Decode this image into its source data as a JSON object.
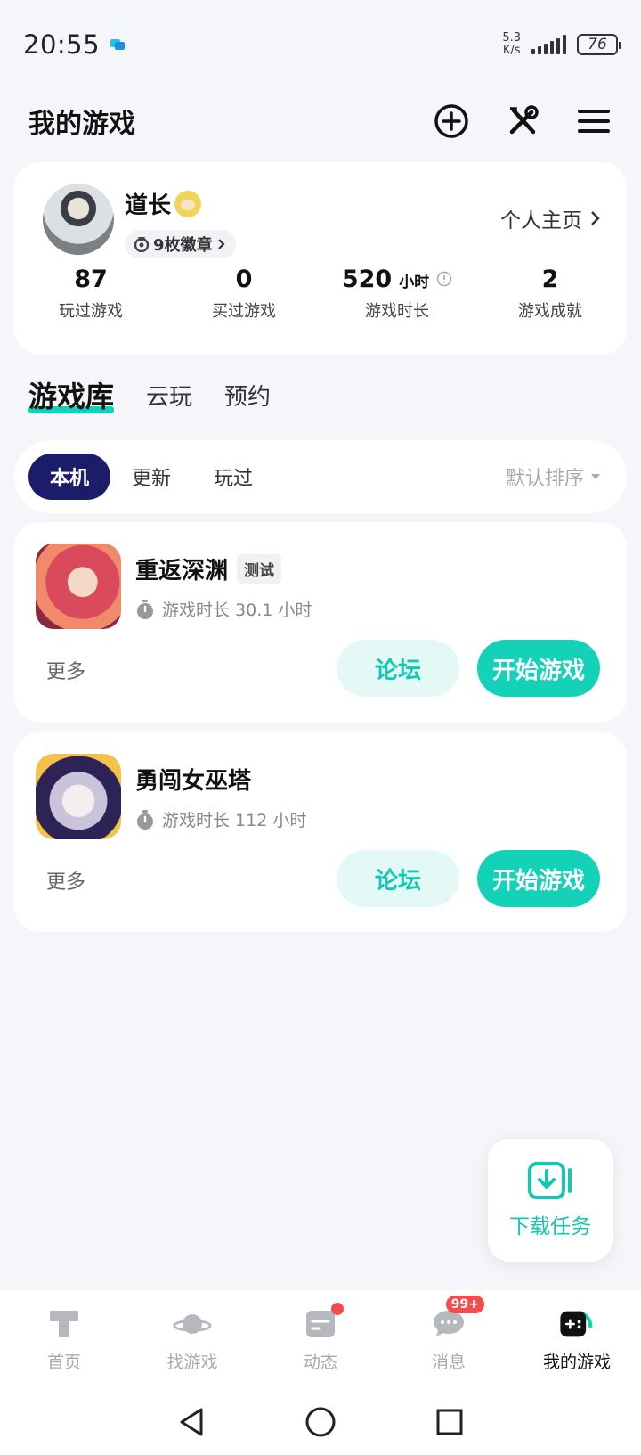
{
  "status": {
    "time": "20:55",
    "net_speed_value": "5.3",
    "net_speed_unit": "K/s",
    "battery": "76"
  },
  "header": {
    "title": "我的游戏"
  },
  "profile": {
    "name": "道长",
    "badges": "9枚徽章",
    "homepage": "个人主页",
    "stats": [
      {
        "value": "87",
        "unit": "",
        "label": "玩过游戏"
      },
      {
        "value": "0",
        "unit": "",
        "label": "买过游戏"
      },
      {
        "value": "520",
        "unit": "小时",
        "label": "游戏时长"
      },
      {
        "value": "2",
        "unit": "",
        "label": "游戏成就"
      }
    ]
  },
  "tabs": [
    "游戏库",
    "云玩",
    "预约"
  ],
  "filters": {
    "chips": [
      "本机",
      "更新",
      "玩过"
    ],
    "sort": "默认排序"
  },
  "games": [
    {
      "name": "重返深渊",
      "tag": "测试",
      "play_time": "游戏时长 30.1 小时",
      "more": "更多",
      "forum": "论坛",
      "start": "开始游戏"
    },
    {
      "name": "勇闯女巫塔",
      "tag": "",
      "play_time": "游戏时长 112 小时",
      "more": "更多",
      "forum": "论坛",
      "start": "开始游戏"
    }
  ],
  "download": {
    "label": "下载任务"
  },
  "bottom_nav": [
    {
      "label": "首页",
      "icon": "home-icon"
    },
    {
      "label": "找游戏",
      "icon": "planet-icon"
    },
    {
      "label": "动态",
      "icon": "feed-icon"
    },
    {
      "label": "消息",
      "icon": "chat-icon",
      "badge": "99+"
    },
    {
      "label": "我的游戏",
      "icon": "gamepad-icon"
    }
  ],
  "colors": {
    "accent": "#13d2b8",
    "chip_active": "#1b1d6b",
    "badge": "#f24c4c"
  }
}
